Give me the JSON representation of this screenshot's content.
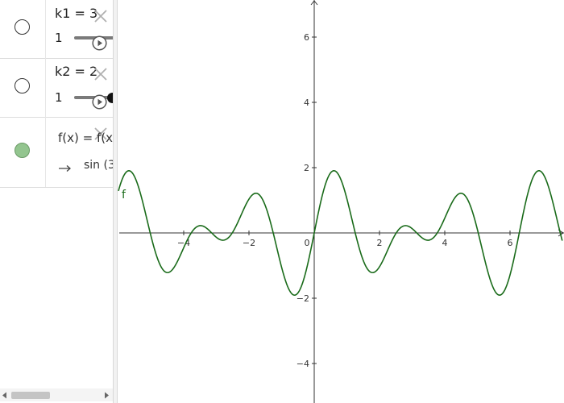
{
  "algebra": {
    "slider1": {
      "label": "k1 = 3",
      "min": "1",
      "value": 3
    },
    "slider2": {
      "label": "k2 = 2",
      "min": "1",
      "value": 2
    },
    "function": {
      "definition": "f(x) = f(x",
      "result": "sin (3"
    }
  },
  "graphics": {
    "function_label": "f",
    "x_ticks": [
      "−4",
      "−2",
      "0",
      "2",
      "4",
      "6"
    ],
    "y_ticks": [
      "6",
      "4",
      "2",
      "−2",
      "−4"
    ]
  },
  "chart_data": {
    "type": "line",
    "title": "",
    "xlabel": "",
    "ylabel": "",
    "xlim": [
      -6,
      7.6
    ],
    "ylim": [
      -5.2,
      7.0
    ],
    "grid": false,
    "series": [
      {
        "name": "f",
        "expression": "sin(3x) + sin(2x)",
        "color": "#1a6b1a"
      }
    ]
  },
  "colors": {
    "curve": "#1a6b1a",
    "visibility_on": "#93c58f",
    "axis": "#333333"
  }
}
